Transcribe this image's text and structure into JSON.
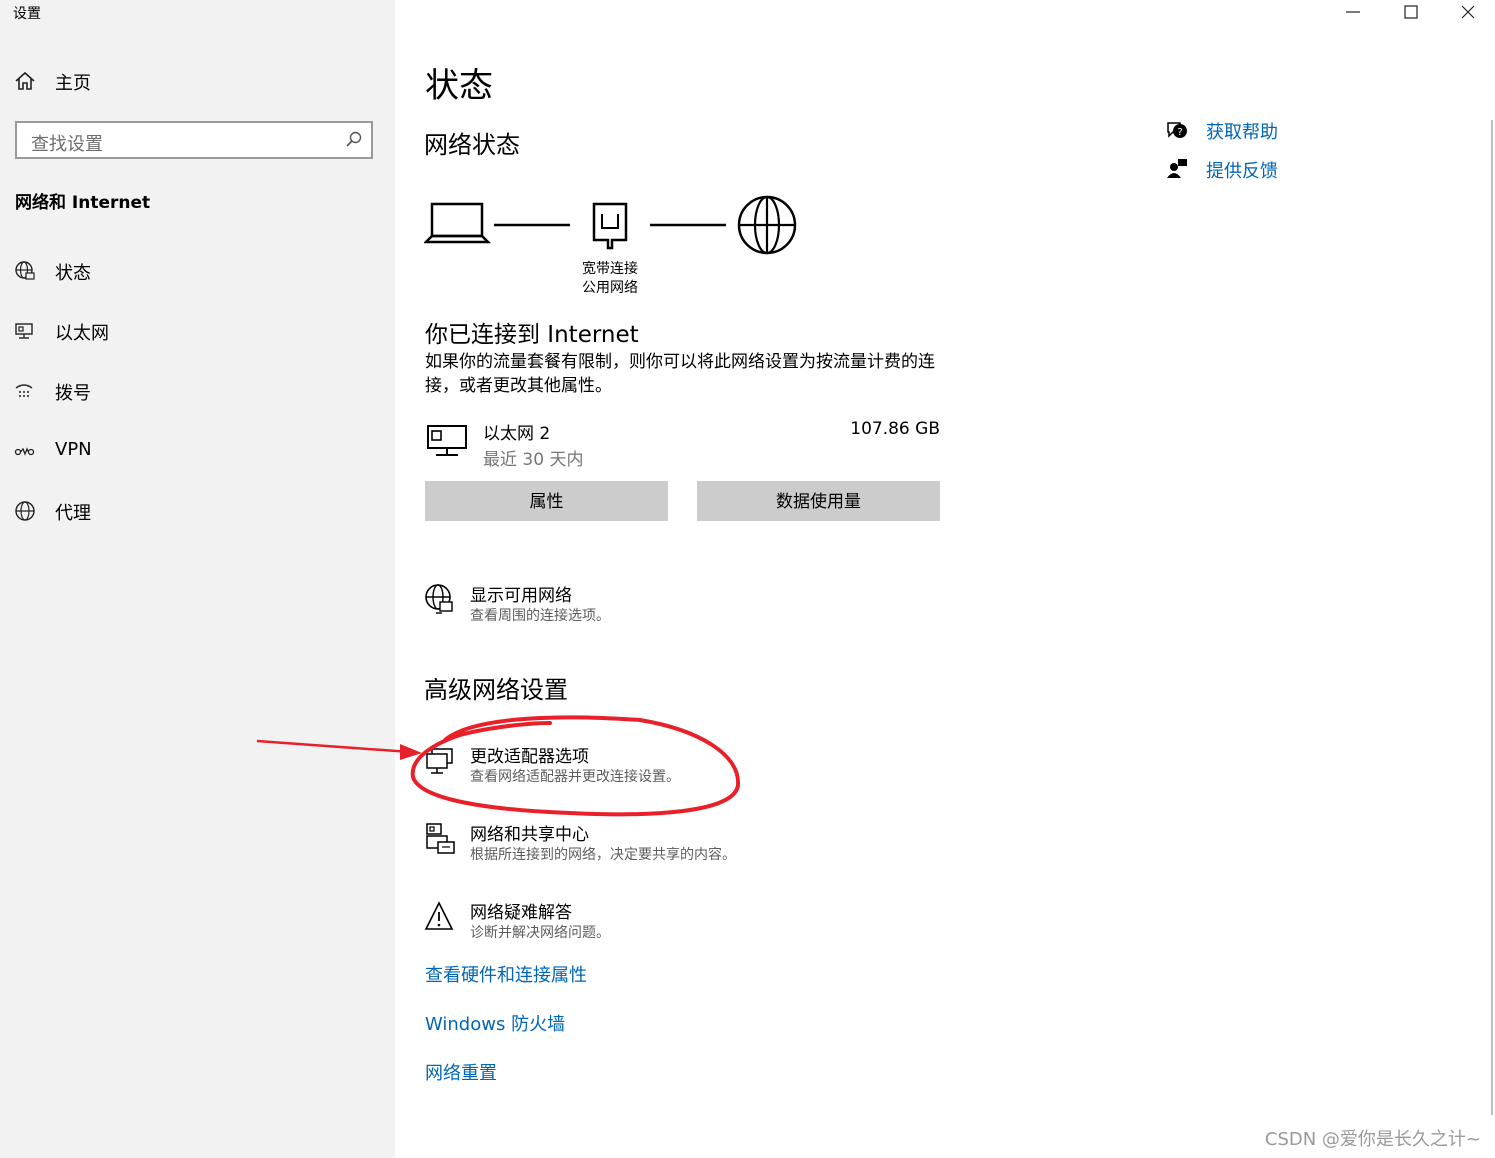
{
  "window": {
    "title": "设置",
    "controls": [
      "minimize-icon",
      "maximize-icon",
      "close-icon"
    ]
  },
  "sidebar": {
    "home_label": "主页",
    "search_placeholder": "查找设置",
    "section_heading": "网络和 Internet",
    "items": [
      {
        "label": "状态",
        "icon": "globe-status-icon"
      },
      {
        "label": "以太网",
        "icon": "ethernet-icon"
      },
      {
        "label": "拨号",
        "icon": "dialup-icon"
      },
      {
        "label": "VPN",
        "icon": "vpn-icon"
      },
      {
        "label": "代理",
        "icon": "globe-icon"
      }
    ]
  },
  "main": {
    "title": "状态",
    "network_status_heading": "网络状态",
    "diagram": {
      "connection_name": "宽带连接",
      "network_type": "公用网络"
    },
    "connected_title": "你已连接到 Internet",
    "connected_desc": "如果你的流量套餐有限制，则你可以将此网络设置为按流量计费的连接，或者更改其他属性。",
    "adapter": {
      "name": "以太网 2",
      "period": "最近 30 天内",
      "usage": "107.86 GB"
    },
    "buttons": {
      "properties": "属性",
      "data_usage": "数据使用量"
    },
    "show_networks": {
      "title": "显示可用网络",
      "subtitle": "查看周围的连接选项。"
    },
    "advanced_heading": "高级网络设置",
    "advanced_items": [
      {
        "title": "更改适配器选项",
        "subtitle": "查看网络适配器并更改连接设置。",
        "icon": "adapter-icon"
      },
      {
        "title": "网络和共享中心",
        "subtitle": "根据所连接到的网络，决定要共享的内容。",
        "icon": "sharing-center-icon"
      },
      {
        "title": "网络疑难解答",
        "subtitle": "诊断并解决网络问题。",
        "icon": "warning-icon"
      }
    ],
    "links": [
      "查看硬件和连接属性",
      "Windows 防火墙",
      "网络重置"
    ]
  },
  "help": {
    "get_help": "获取帮助",
    "feedback": "提供反馈"
  },
  "annotation": {
    "color": "#e8202a"
  },
  "watermark": "CSDN @爱你是长久之计~",
  "colors": {
    "link": "#0067b8",
    "sidebar_bg": "#f2f2f2",
    "button_bg": "#cccccc"
  }
}
